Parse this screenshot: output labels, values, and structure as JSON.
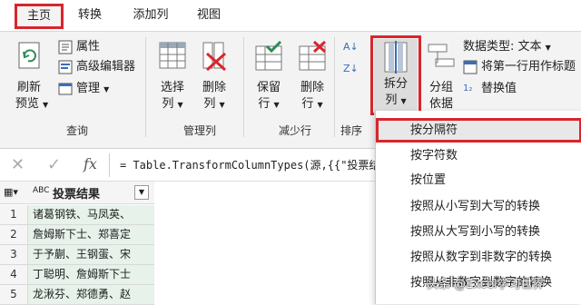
{
  "tabs": [
    "主页",
    "转换",
    "添加列",
    "视图"
  ],
  "ribbon": {
    "refresh": {
      "l1": "刷新",
      "l2": "预览"
    },
    "properties": "属性",
    "advanced_editor": "高级编辑器",
    "manage": "管理",
    "group_query": "查询",
    "choose_cols": {
      "l1": "选择",
      "l2": "列"
    },
    "remove_cols": {
      "l1": "删除",
      "l2": "列"
    },
    "group_manage_cols": "管理列",
    "keep_rows": {
      "l1": "保留",
      "l2": "行"
    },
    "remove_rows": {
      "l1": "删除",
      "l2": "行"
    },
    "group_reduce_rows": "减少行",
    "group_sort": "排序",
    "split_column": {
      "l1": "拆分",
      "l2": "列"
    },
    "group_by": {
      "l1": "分组",
      "l2": "依据"
    },
    "data_type": "数据类型: 文本",
    "first_row_header": "将第一行用作标题",
    "replace_values": "替换值"
  },
  "formula": {
    "fx": "fx",
    "text": "= Table.TransformColumnTypes(源,{{\"投票结"
  },
  "grid": {
    "header": "投票结果",
    "type_label": "ABC",
    "rows": [
      {
        "n": "1",
        "v": "诸葛钢铁、马凤英、"
      },
      {
        "n": "2",
        "v": "詹姆斯下士、郑喜定"
      },
      {
        "n": "3",
        "v": "于予蒯、王钢蛋、宋"
      },
      {
        "n": "4",
        "v": "丁聪明、詹姆斯下士"
      },
      {
        "n": "5",
        "v": "龙湫芬、郑德勇、赵"
      }
    ]
  },
  "menu": [
    "按分隔符",
    "按字符数",
    "按位置",
    "按照从小写到大写的转换",
    "按照从大写到小写的转换",
    "按照从数字到非数字的转换",
    "按照从非数字到数字的转换"
  ],
  "watermark": "头条 @Excel学习世界",
  "colors": {
    "accent_red": "#d9252d",
    "grid_fill": "#e6f2ea"
  }
}
